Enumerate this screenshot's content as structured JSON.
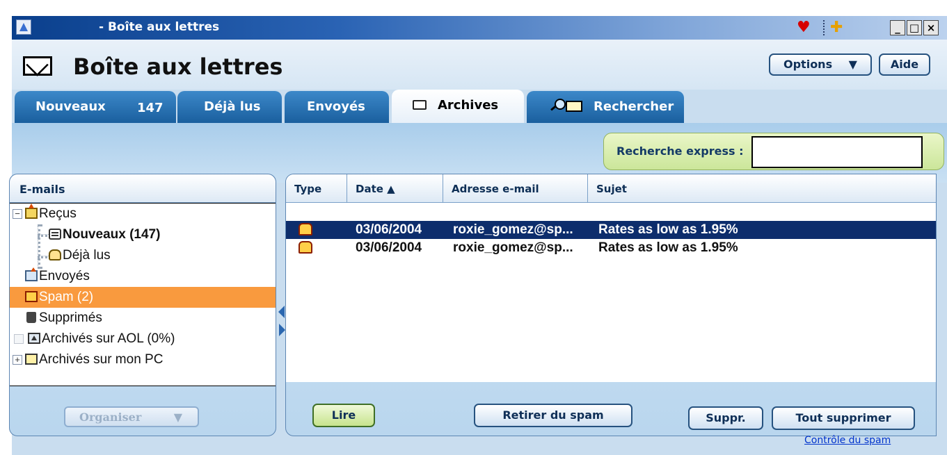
{
  "window": {
    "title": "- Boîte aux lettres",
    "controls": [
      "_",
      "□",
      "×"
    ]
  },
  "header": {
    "title": "Boîte aux lettres",
    "options_label": "Options",
    "options_arrow": "▼",
    "help_label": "Aide"
  },
  "tabs": [
    {
      "label": "Nouveaux",
      "count": "147"
    },
    {
      "label": "Déjà lus"
    },
    {
      "label": "Envoyés"
    },
    {
      "label": "Archives",
      "active": true
    },
    {
      "label": "Rechercher"
    }
  ],
  "quick_search": {
    "label": "Recherche express :",
    "value": ""
  },
  "folders": {
    "header": "E-mails",
    "items": [
      {
        "label": "Reçus",
        "expander": "−"
      },
      {
        "label": "Nouveaux (147)"
      },
      {
        "label": "Déjà lus"
      },
      {
        "label": "Envoyés"
      },
      {
        "label": "Spam (2)",
        "selected": true
      },
      {
        "label": "Supprimés"
      },
      {
        "label": "Archivés sur AOL  (0%)"
      },
      {
        "label": "Archivés sur mon PC",
        "expander": "+"
      }
    ],
    "organize_label": "Organiser",
    "organize_arrow": "▼"
  },
  "messages": {
    "columns": [
      "Type",
      "Date ▲",
      "Adresse e-mail",
      "Sujet"
    ],
    "rows": [
      {
        "date": "03/06/2004",
        "email": "roxie_gomez@sp...",
        "subject": "Rates as low as 1.95%",
        "selected": true
      },
      {
        "date": "03/06/2004",
        "email": "roxie_gomez@sp...",
        "subject": "Rates as low as 1.95%"
      }
    ]
  },
  "actions": {
    "read": "Lire",
    "unspam": "Retirer du spam",
    "delete": "Suppr.",
    "delete_all": "Tout supprimer",
    "spam_control_link": "Contrôle du spam"
  },
  "colors": {
    "title_bar": "#0a3f8c",
    "selected_folder": "#f99a3e",
    "selected_message": "#0d2d6c",
    "accent_green": "#c7e48d"
  }
}
